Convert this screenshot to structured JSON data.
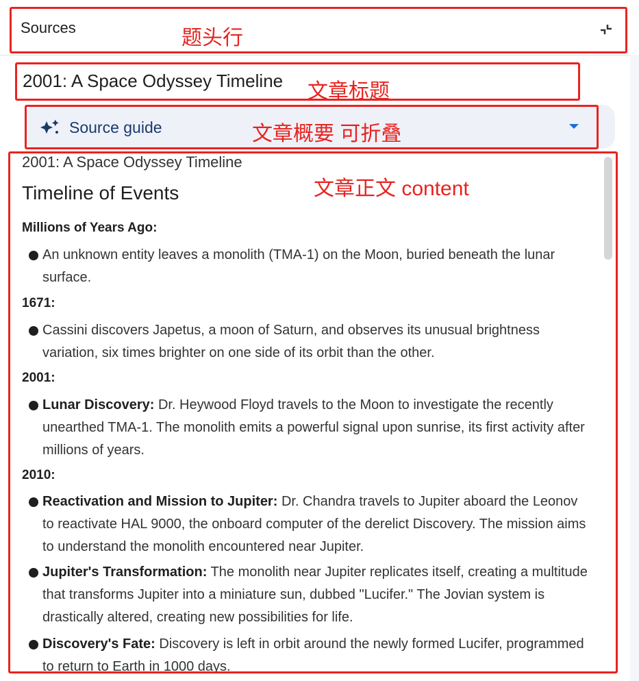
{
  "header": {
    "title": "Sources",
    "annotation": "题头行"
  },
  "article": {
    "title": "2001: A Space Odyssey Timeline",
    "annotation": "文章标题"
  },
  "source_guide": {
    "label": "Source guide",
    "annotation": "文章概要 可折叠"
  },
  "content": {
    "annotation": "文章正文 content",
    "doc_title": "2001: A Space Odyssey Timeline",
    "heading": "Timeline of Events",
    "sections": [
      {
        "title": "Millions of Years Ago:",
        "items": [
          {
            "lead": "",
            "text": "An unknown entity leaves a monolith (TMA-1) on the Moon, buried beneath the lunar surface."
          }
        ]
      },
      {
        "title": "1671:",
        "items": [
          {
            "lead": "",
            "text": "Cassini discovers Japetus, a moon of Saturn, and observes its unusual brightness variation, six times brighter on one side of its orbit than the other."
          }
        ]
      },
      {
        "title": "2001:",
        "items": [
          {
            "lead": "Lunar Discovery:",
            "text": " Dr. Heywood Floyd travels to the Moon to investigate the recently unearthed TMA-1. The monolith emits a powerful signal upon sunrise, its first activity after millions of years."
          }
        ]
      },
      {
        "title": "2010:",
        "items": [
          {
            "lead": "Reactivation and Mission to Jupiter:",
            "text": " Dr. Chandra travels to Jupiter aboard the Leonov to reactivate HAL 9000, the onboard computer of the derelict Discovery. The mission aims to understand the monolith encountered near Jupiter."
          },
          {
            "lead": "Jupiter's Transformation:",
            "text": " The monolith near Jupiter replicates itself, creating a multitude that transforms Jupiter into a miniature sun, dubbed \"Lucifer.\" The Jovian system is drastically altered, creating new possibilities for life."
          },
          {
            "lead": "Discovery's Fate:",
            "text": " Discovery is left in orbit around the newly formed Lucifer, programmed to return to Earth in 1000 days."
          }
        ]
      }
    ]
  },
  "colors": {
    "annotation_red": "#e8231f",
    "guide_bg": "#eef1f8",
    "guide_text": "#1b3a6b",
    "caret_blue": "#1a6fd8"
  }
}
